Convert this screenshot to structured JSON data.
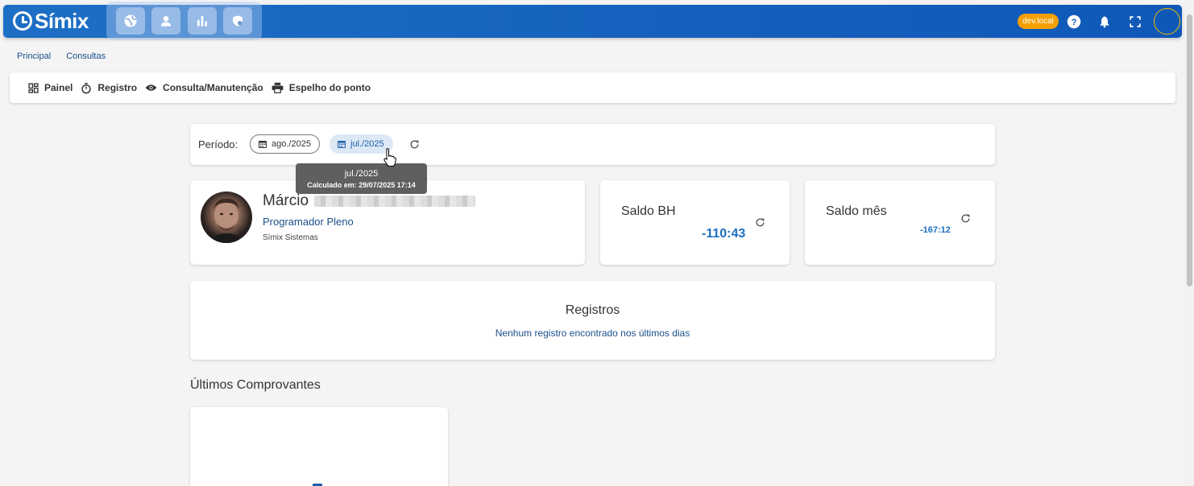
{
  "app": {
    "logo_text": "Símix",
    "env_badge": "dev.local",
    "module_icons": [
      "globe-icon",
      "person-icon",
      "bar-chart-icon",
      "shield-icon"
    ]
  },
  "breadcrumb": [
    "Principal",
    "Consultas"
  ],
  "nav": {
    "items": [
      {
        "label": "Painel",
        "icon": "dashboard-icon"
      },
      {
        "label": "Registro",
        "icon": "stopwatch-icon"
      },
      {
        "label": "Consulta/Manutenção",
        "icon": "eye-icon"
      },
      {
        "label": "Espelho do ponto",
        "icon": "printer-icon"
      }
    ]
  },
  "periodo": {
    "label": "Período:",
    "options": [
      "ago./2025",
      "jul./2025"
    ],
    "selected": "jul./2025"
  },
  "tooltip": {
    "title": "jul./2025",
    "detail": "Calculado em: 29/07/2025 17:14"
  },
  "profile": {
    "first_name": "Márcio",
    "role": "Programador Pleno",
    "company": "Símix Sistemas"
  },
  "saldo_bh": {
    "title": "Saldo BH",
    "value": "-110:43"
  },
  "saldo_mes": {
    "title": "Saldo mês",
    "value": "-167:12"
  },
  "registros": {
    "title": "Registros",
    "empty_message": "Nenhum registro encontrado nos últimos dias"
  },
  "comprovantes": {
    "title": "Últimos Comprovantes"
  },
  "colors": {
    "primary": "#1560bd",
    "badge": "#f5a000",
    "link": "#1b4f8a",
    "value": "#1d6fc4"
  }
}
